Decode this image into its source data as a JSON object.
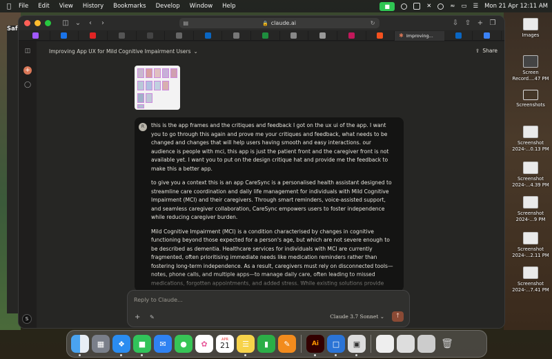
{
  "menubar": {
    "app": "Safari",
    "items": [
      "File",
      "Edit",
      "View",
      "History",
      "Bookmarks",
      "Develop",
      "Window",
      "Help"
    ],
    "datetime": "Mon 21 Apr  12:11 AM"
  },
  "browser": {
    "url": "claude.ai",
    "active_tab": "Improving..."
  },
  "chat": {
    "title": "Improving App UX for Mild Cognitive Impairment Users",
    "share_label": "Share",
    "user_initial": "R",
    "sidebar_user": "S",
    "paragraphs": [
      "this is the app frames and the critiques and feedback I got on the ux ui of the app. I want you to go through this again and prove me your critiques and feedback, what needs to be changed and changes that will help users having smooth and easy interactions. our audience is people with mci, this app is just the patient front and the caregiver front is not available yet. I want you to put on the design critique hat and provide me the feedback to make this a better app.",
      "to give you a context this is an app CareSync is a personalised health assistant designed to streamline care coordination and daily life management for individuals with Mild Cognitive Impairment (MCI) and their caregivers. Through smart reminders, voice-assisted support, and seamless caregiver collaboration, CareSync empowers users to foster independence while reducing caregiver burden.",
      "Mild Cognitive Impairment (MCI) is a condition characterised by changes in cognitive functioning beyond those expected for a person's age, but which are not severe enough to be described as dementia. Healthcare services for individuals with MCI are currently fragmented, often prioritising immediate needs like medication reminders rather than fostering long-term independence. As a result, caregivers must rely on disconnected tools—notes, phone calls, and multiple apps—to manage daily care, often leading to missed medications, forgotten appointments, and added stress. While existing solutions provide"
    ]
  },
  "composer": {
    "placeholder": "Reply to Claude...",
    "model": "Claude 3.7 Sonnet"
  },
  "desktop": [
    {
      "label": "Images"
    },
    {
      "label": "Screen Record....47 PM"
    },
    {
      "label": "Screenshots"
    },
    {
      "label": "Screenshot 2024-...0.13 PM"
    },
    {
      "label": "Screenshot 2024-...4.39 PM"
    },
    {
      "label": "Screenshot 2024-...9 PM"
    },
    {
      "label": "Screenshot 2024-...2.11 PM"
    },
    {
      "label": "Screenshot 2024-...7.41 PM"
    }
  ],
  "dock": {
    "calendar_month": "APR",
    "calendar_day": "21"
  },
  "colors": {
    "accent": "#d97757",
    "bubble": "#141413",
    "app_bg": "#262624"
  }
}
